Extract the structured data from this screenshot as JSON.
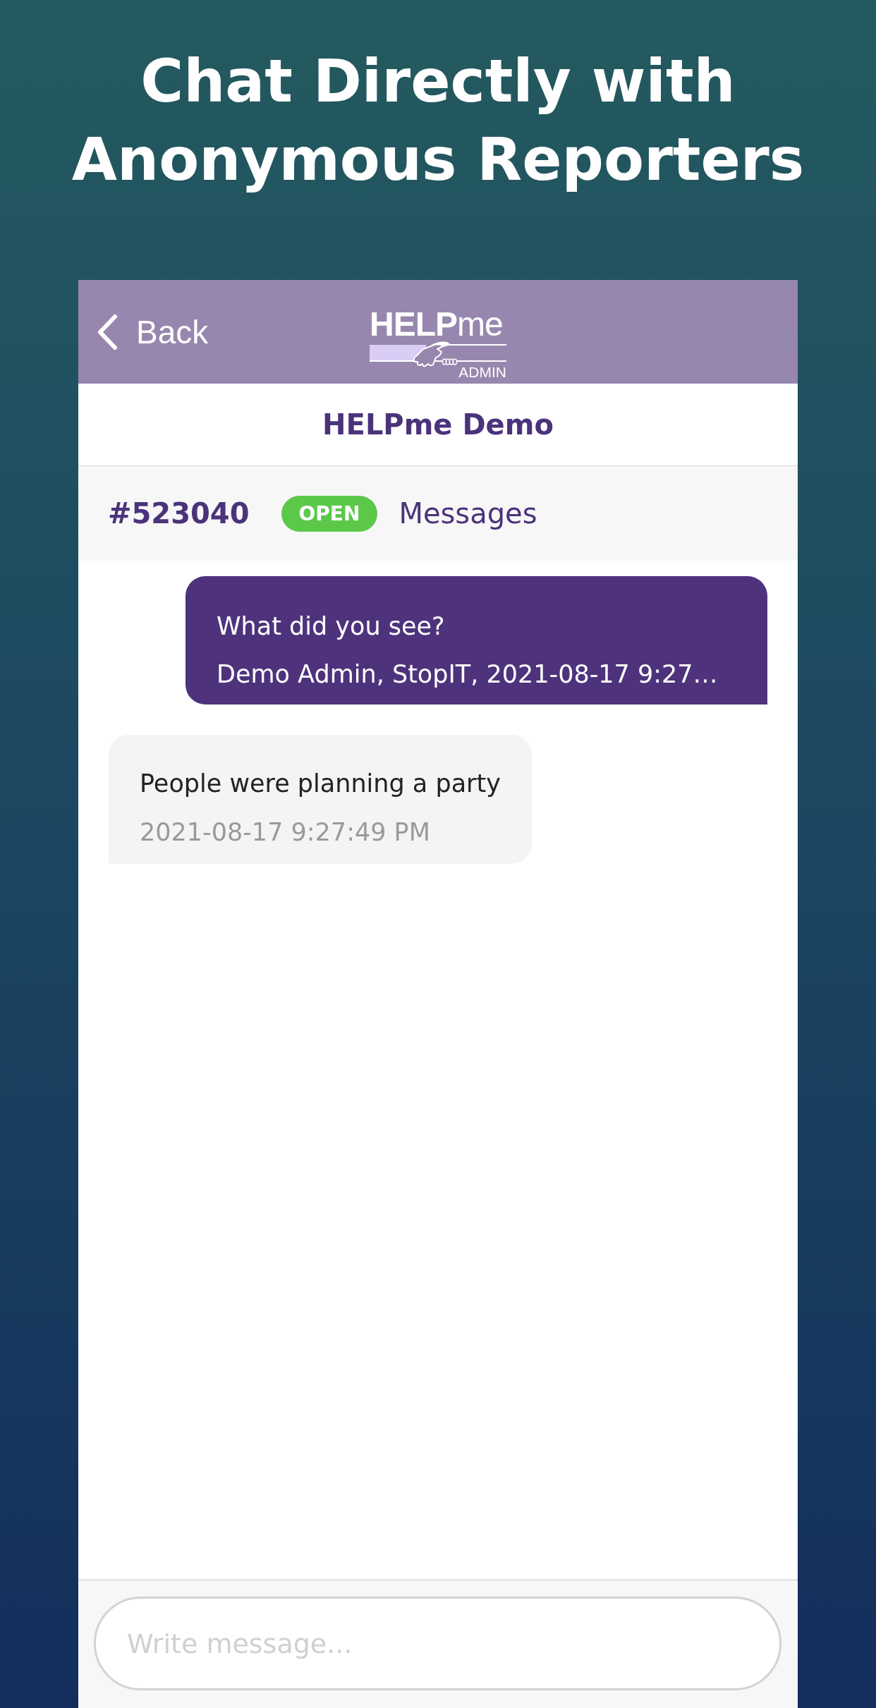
{
  "headline": "Chat Directly with Anonymous Reporters",
  "nav": {
    "back_label": "Back",
    "logo": {
      "wordmark": "**HELP**me",
      "subtitle": "ADMIN"
    }
  },
  "title": "HELPme Demo",
  "ticket": {
    "number": "#523040",
    "status": "OPEN",
    "section": "Messages"
  },
  "messages": [
    {
      "kind": "sent",
      "text": "What did you see?",
      "meta": "Demo Admin, StopIT, 2021-08-17 9:27…"
    },
    {
      "kind": "received",
      "text": "People were planning a party",
      "meta": "2021-08-17 9:27:49 PM"
    }
  ],
  "composer": {
    "placeholder": "Write message..."
  }
}
